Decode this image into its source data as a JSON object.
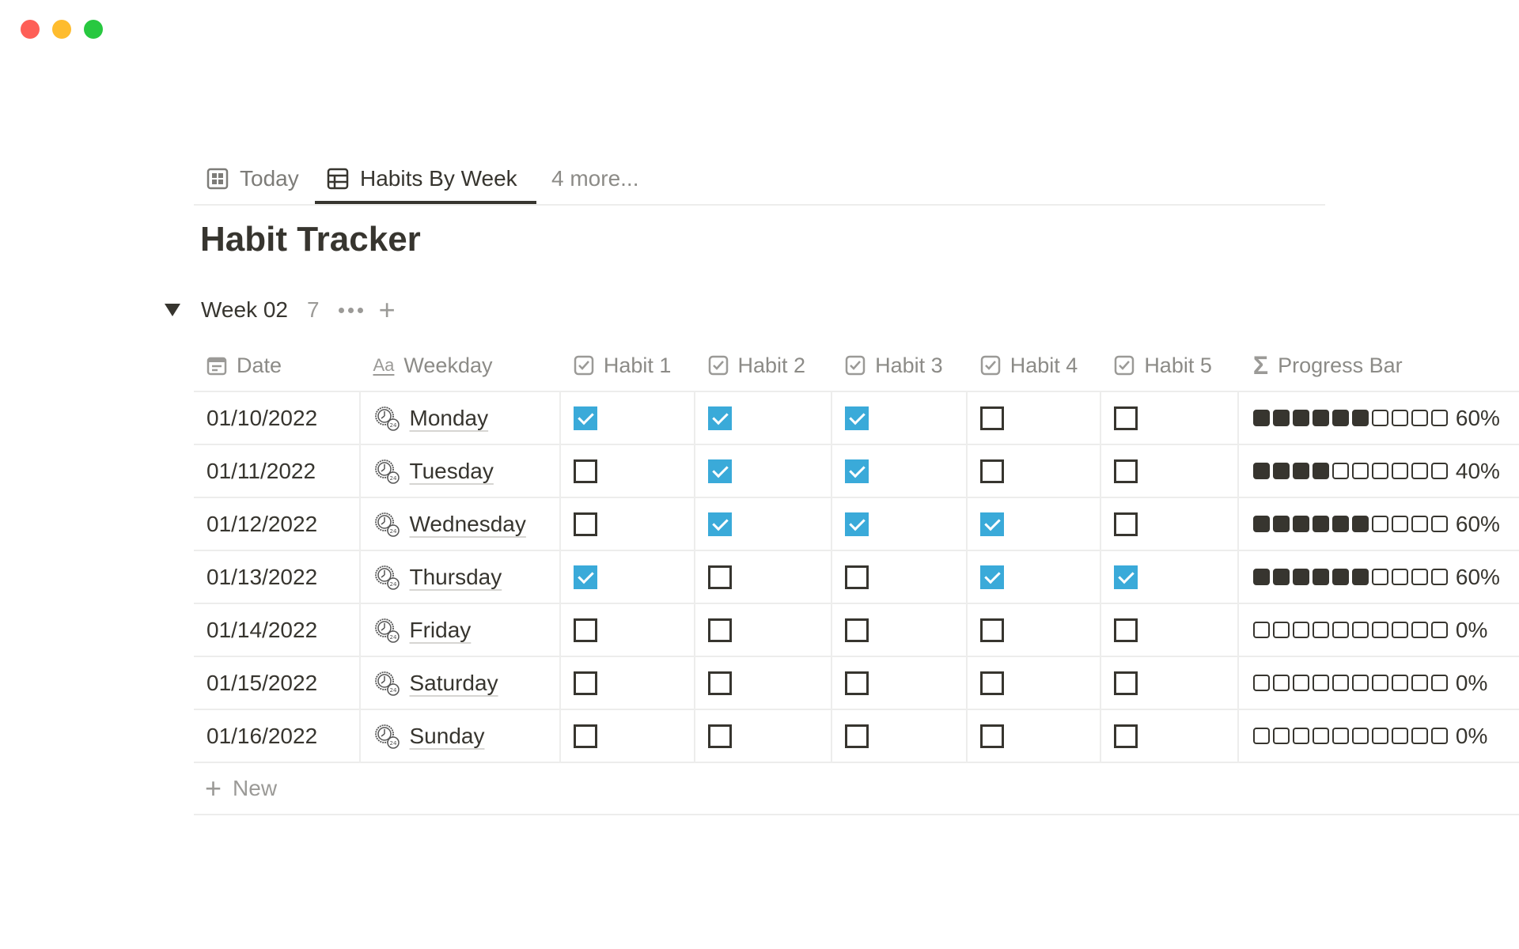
{
  "window": {
    "controls": [
      "close",
      "minimize",
      "zoom"
    ]
  },
  "tabs": [
    {
      "label": "Today",
      "icon": "gallery-icon",
      "active": false
    },
    {
      "label": "Habits By Week",
      "icon": "table-icon",
      "active": true
    },
    {
      "label": "4 more...",
      "icon": null,
      "active": false
    }
  ],
  "page": {
    "title": "Habit Tracker"
  },
  "group": {
    "name": "Week 02",
    "count": "7"
  },
  "columns": [
    {
      "label": "Date",
      "icon": "calendar-icon"
    },
    {
      "label": "Weekday",
      "icon": "text-property-icon"
    },
    {
      "label": "Habit 1",
      "icon": "checkbox-property-icon"
    },
    {
      "label": "Habit 2",
      "icon": "checkbox-property-icon"
    },
    {
      "label": "Habit 3",
      "icon": "checkbox-property-icon"
    },
    {
      "label": "Habit 4",
      "icon": "checkbox-property-icon"
    },
    {
      "label": "Habit 5",
      "icon": "checkbox-property-icon"
    },
    {
      "label": "Progress Bar",
      "icon": "formula-sigma-icon"
    }
  ],
  "rows": [
    {
      "date": "01/10/2022",
      "weekday": "Monday",
      "habits": [
        true,
        true,
        true,
        false,
        false
      ],
      "progress_filled": 6,
      "progress_total": 10,
      "progress_label": "60%"
    },
    {
      "date": "01/11/2022",
      "weekday": "Tuesday",
      "habits": [
        false,
        true,
        true,
        false,
        false
      ],
      "progress_filled": 4,
      "progress_total": 10,
      "progress_label": "40%"
    },
    {
      "date": "01/12/2022",
      "weekday": "Wednesday",
      "habits": [
        false,
        true,
        true,
        true,
        false
      ],
      "progress_filled": 6,
      "progress_total": 10,
      "progress_label": "60%"
    },
    {
      "date": "01/13/2022",
      "weekday": "Thursday",
      "habits": [
        true,
        false,
        false,
        true,
        true
      ],
      "progress_filled": 6,
      "progress_total": 10,
      "progress_label": "60%"
    },
    {
      "date": "01/14/2022",
      "weekday": "Friday",
      "habits": [
        false,
        false,
        false,
        false,
        false
      ],
      "progress_filled": 0,
      "progress_total": 10,
      "progress_label": "0%"
    },
    {
      "date": "01/15/2022",
      "weekday": "Saturday",
      "habits": [
        false,
        false,
        false,
        false,
        false
      ],
      "progress_filled": 0,
      "progress_total": 10,
      "progress_label": "0%"
    },
    {
      "date": "01/16/2022",
      "weekday": "Sunday",
      "habits": [
        false,
        false,
        false,
        false,
        false
      ],
      "progress_filled": 0,
      "progress_total": 10,
      "progress_label": "0%"
    }
  ],
  "new_row": {
    "label": "New"
  },
  "colors": {
    "checkbox_checked": "#3aaad9",
    "text": "#37352f",
    "muted": "#8c8b87",
    "divider": "#ededec"
  }
}
